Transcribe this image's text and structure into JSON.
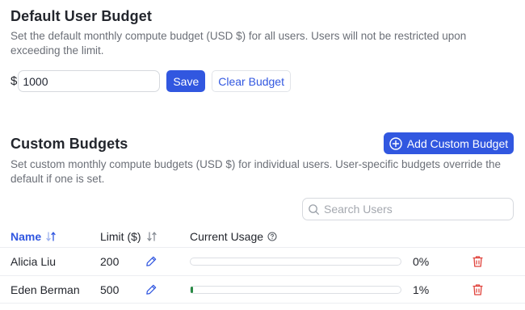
{
  "default_budget": {
    "title": "Default User Budget",
    "description": "Set the default monthly compute budget (USD $) for all users. Users will not be restricted upon exceeding the limit.",
    "currency_symbol": "$",
    "value": "1000",
    "save_label": "Save",
    "clear_label": "Clear Budget"
  },
  "custom_budgets": {
    "title": "Custom Budgets",
    "add_label": "Add Custom Budget",
    "description": "Set custom monthly compute budgets (USD $) for individual users. User-specific budgets override the default if one is set.",
    "search_placeholder": "Search Users",
    "columns": {
      "name": "Name",
      "limit": "Limit ($)",
      "usage": "Current Usage"
    },
    "rows": [
      {
        "name": "Alicia Liu",
        "limit": "200",
        "usage_label": "0%",
        "usage_fraction": 0.0
      },
      {
        "name": "Eden Berman",
        "limit": "500",
        "usage_label": "1%",
        "usage_fraction": 0.01
      }
    ]
  },
  "colors": {
    "accent": "#3157e0",
    "usage_fill": "#2a8a46",
    "delete": "#e0413a"
  },
  "icons": [
    "sort-icon",
    "plus-circle-icon",
    "search-icon",
    "info-icon",
    "pencil-icon",
    "trash-icon"
  ]
}
